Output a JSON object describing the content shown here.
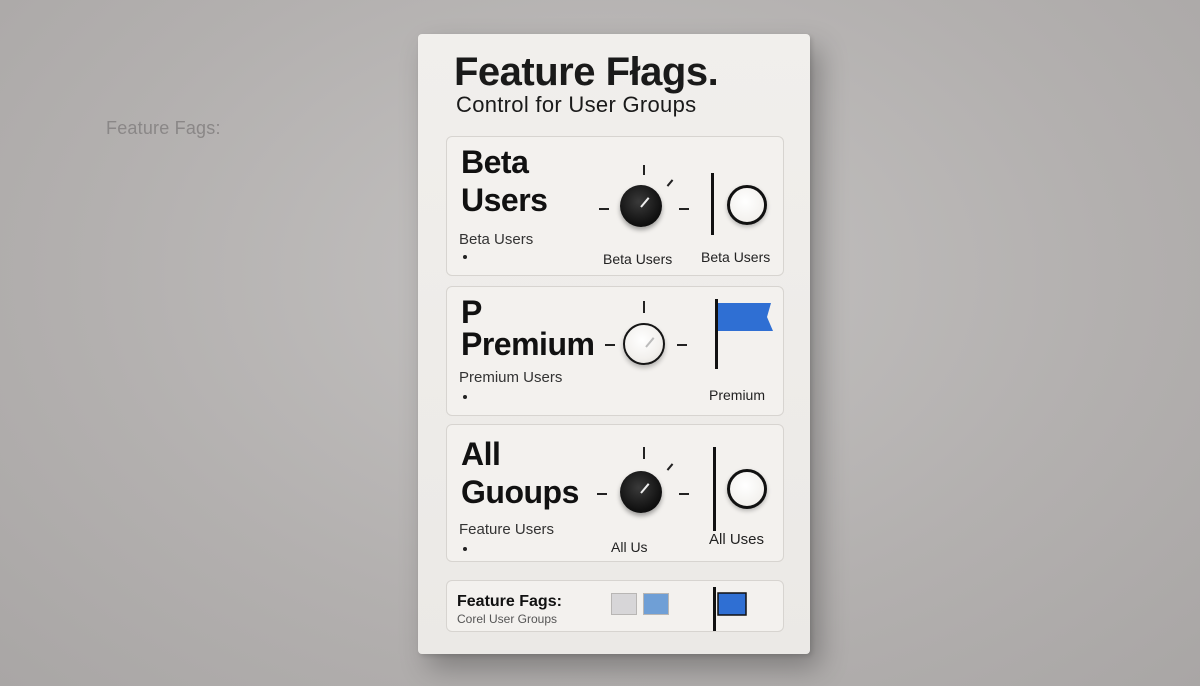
{
  "background_label": "Feature Fags:",
  "panel": {
    "title": "Feature Fłags.",
    "subtitle": "Control for User Groups"
  },
  "groups": [
    {
      "name_line1": "Beta",
      "name_line2": "Users",
      "sublabel": "Beta Users",
      "knob_state": "dark",
      "knob_label": "Beta Users",
      "indicator": "toggle",
      "indicator_label": "Beta Users"
    },
    {
      "name_line1": "P",
      "name_line2": "Premium",
      "sublabel": "Premium Users",
      "knob_state": "light",
      "knob_label": "",
      "indicator": "flag",
      "indicator_label": "Premium"
    },
    {
      "name_line1": "All",
      "name_line2": "Guoups",
      "sublabel": "Feature Users",
      "knob_state": "dark",
      "knob_label": "All Us",
      "indicator": "toggle",
      "indicator_label": "All Uses"
    }
  ],
  "footer": {
    "title": "Feature Fags:",
    "subtitle": "Corel User Groups",
    "swatch_colors": [
      "#d7d6d8",
      "#6f9fd6"
    ]
  },
  "colors": {
    "flag_blue": "#2f6fd3",
    "panel": "#efede9",
    "wall": "#b5b2b1"
  }
}
